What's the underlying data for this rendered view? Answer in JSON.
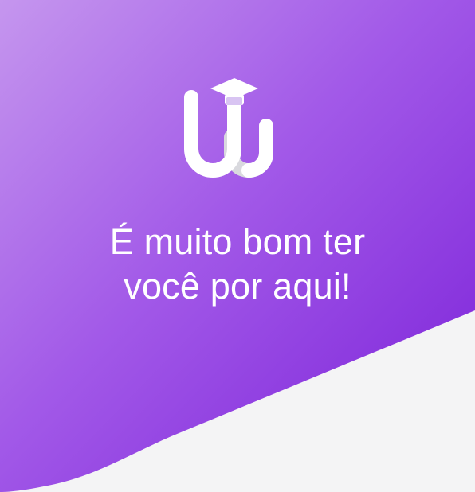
{
  "theme": {
    "gradient_start": "#c596ee",
    "gradient_mid": "#9a4fe6",
    "gradient_end": "#7a1fd8",
    "background": "#f4f4f5",
    "text_color": "#ffffff"
  },
  "logo": {
    "icon": "graduation-cap-uw-logo"
  },
  "welcome": {
    "line1": "É muito bom ter",
    "line2": "você por aqui!"
  }
}
